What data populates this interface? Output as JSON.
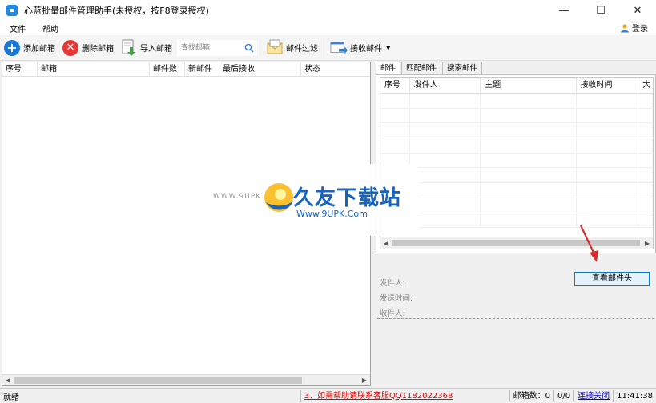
{
  "window": {
    "title": "心蓝批量邮件管理助手(未授权，按F8登录授权)",
    "minimize": "—",
    "maximize": "☐",
    "close": "✕"
  },
  "menu": {
    "items": [
      "文件",
      "帮助"
    ],
    "login": "登录"
  },
  "toolbar": {
    "add_mailbox": "添加邮箱",
    "delete_mailbox": "删除邮箱",
    "import_mailbox": "导入邮箱",
    "search_placeholder": "查找邮箱",
    "mail_filter": "邮件过滤",
    "receive_mail": "接收邮件"
  },
  "mailbox_table": {
    "columns": [
      "序号",
      "邮箱",
      "邮件数",
      "新邮件",
      "最后接收",
      "状态"
    ]
  },
  "tabs": [
    "邮件",
    "匹配邮件",
    "搜索邮件"
  ],
  "mail_table": {
    "columns": [
      "序号",
      "发件人",
      "主题",
      "接收时间",
      "大"
    ]
  },
  "detail": {
    "view_header_button": "查看邮件头",
    "from_label": "发件人:",
    "time_label": "发送时间:",
    "to_label": "收件人:"
  },
  "watermark": {
    "site_cn": "久友下载站",
    "url": "Www.9UPK.Com",
    "side_text": "WWW.9UPK.COM"
  },
  "status": {
    "ready": "就绪",
    "help_link": "3、如需帮助请联系客服QQ1182022368",
    "mailbox_count": "邮箱数：0",
    "ratio": "0/0",
    "connection": "连接关闭",
    "time": "11:41:38"
  },
  "colors": {
    "accent": "#1976d2",
    "danger": "#e53935",
    "link_red": "#e00000",
    "arrow_red": "#d32f2f"
  }
}
